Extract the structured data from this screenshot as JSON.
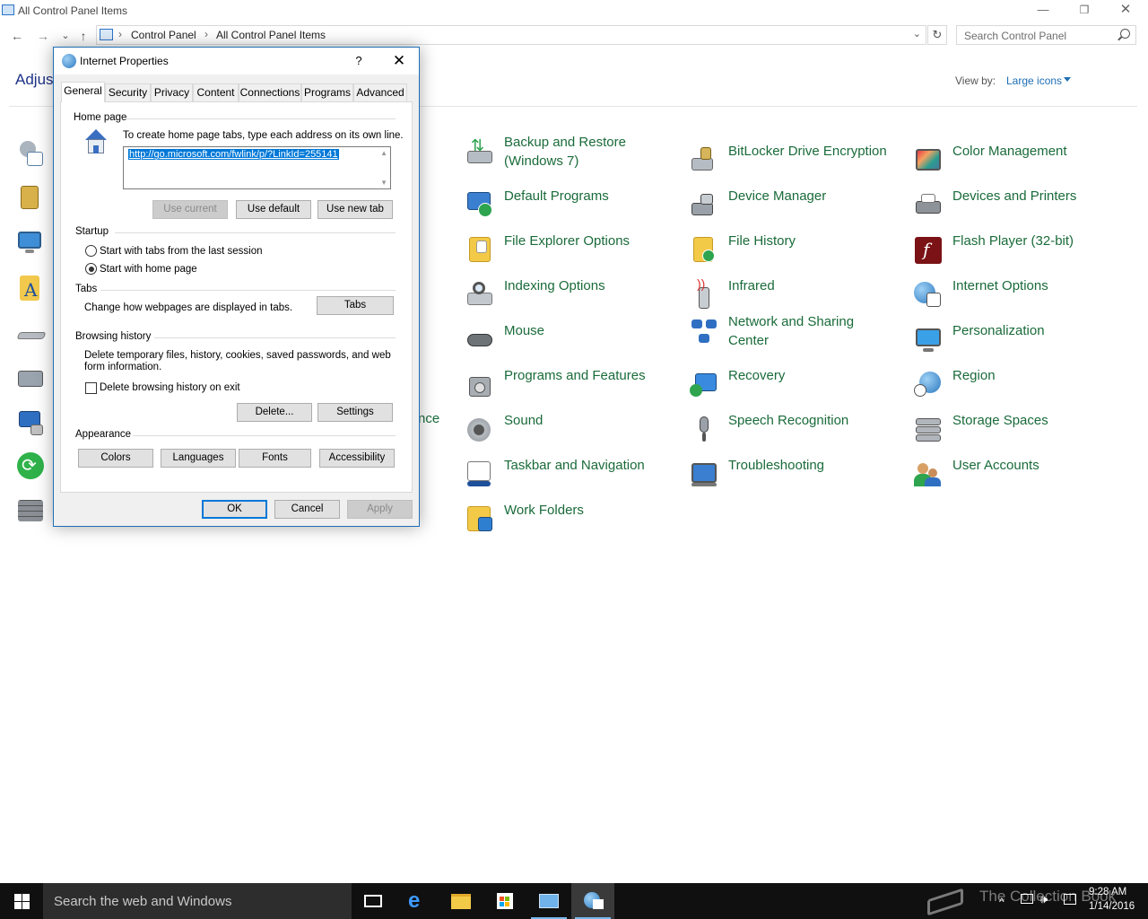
{
  "window": {
    "title": "All Control Panel Items",
    "minimize": "—",
    "restore": "❐",
    "close": "✕"
  },
  "address": {
    "crumbs": [
      "Control Panel",
      "All Control Panel Items"
    ],
    "separator": "›",
    "search_placeholder": "Search Control Panel",
    "refresh": "↻"
  },
  "nav": {
    "back": "←",
    "forward": "→",
    "recent": "⌄",
    "up": "↑"
  },
  "heading": "Adjust",
  "view_by": {
    "label": "View by:",
    "value": "Large icons"
  },
  "items": {
    "col1": [
      {
        "label": "Backup and Restore",
        "label2": "(Windows 7)",
        "icon": "backup-restore-icon"
      },
      {
        "label": "Default Programs",
        "icon": "default-programs-icon"
      },
      {
        "label": "File Explorer Options",
        "icon": "folder-options-icon"
      },
      {
        "label": "Indexing Options",
        "icon": "indexing-icon"
      },
      {
        "label": "Mouse",
        "icon": "mouse-icon"
      },
      {
        "label": "Programs and Features",
        "icon": "programs-features-icon"
      },
      {
        "label": "Sound",
        "icon": "sound-icon"
      },
      {
        "label": "Taskbar and Navigation",
        "icon": "taskbar-icon"
      },
      {
        "label": "Work Folders",
        "icon": "work-folders-icon"
      }
    ],
    "col2": [
      {
        "label": "BitLocker Drive Encryption",
        "icon": "bitlocker-icon"
      },
      {
        "label": "Device Manager",
        "icon": "device-manager-icon"
      },
      {
        "label": "File History",
        "icon": "file-history-icon"
      },
      {
        "label": "Infrared",
        "icon": "infrared-icon"
      },
      {
        "label": "Network and Sharing",
        "label2": "Center",
        "icon": "network-icon"
      },
      {
        "label": "Recovery",
        "icon": "recovery-icon"
      },
      {
        "label": "Speech Recognition",
        "icon": "microphone-icon"
      },
      {
        "label": "Troubleshooting",
        "icon": "troubleshooting-icon"
      }
    ],
    "col3": [
      {
        "label": "Color Management",
        "icon": "color-management-icon"
      },
      {
        "label": "Devices and Printers",
        "icon": "printer-icon"
      },
      {
        "label": "Flash Player (32-bit)",
        "icon": "flash-icon"
      },
      {
        "label": "Internet Options",
        "icon": "internet-options-icon"
      },
      {
        "label": "Personalization",
        "icon": "personalization-icon"
      },
      {
        "label": "Region",
        "icon": "region-icon"
      },
      {
        "label": "Storage Spaces",
        "icon": "storage-spaces-icon"
      },
      {
        "label": "User Accounts",
        "icon": "user-accounts-icon"
      }
    ],
    "partial_label": "nce"
  },
  "dialog": {
    "title": "Internet Properties",
    "help": "?",
    "close": "✕",
    "tabs": [
      "General",
      "Security",
      "Privacy",
      "Content",
      "Connections",
      "Programs",
      "Advanced"
    ],
    "home_page": {
      "group": "Home page",
      "instructions": "To create home page tabs, type each address on its own line.",
      "url": "http://go.microsoft.com/fwlink/p/?LinkId=255141",
      "use_current": "Use current",
      "use_default": "Use default",
      "use_new_tab": "Use new tab"
    },
    "startup": {
      "group": "Startup",
      "option1": "Start with tabs from the last session",
      "option2": "Start with home page"
    },
    "tabs_group": {
      "group": "Tabs",
      "description": "Change how webpages are displayed in tabs.",
      "button": "Tabs"
    },
    "browsing_history": {
      "group": "Browsing history",
      "description_line1": "Delete temporary files, history, cookies, saved passwords, and web",
      "description_line2": "form information.",
      "delete_on_exit": "Delete browsing history on exit",
      "delete": "Delete...",
      "settings": "Settings"
    },
    "appearance": {
      "group": "Appearance",
      "colors": "Colors",
      "languages": "Languages",
      "fonts": "Fonts",
      "accessibility": "Accessibility"
    },
    "ok": "OK",
    "cancel": "Cancel",
    "apply": "Apply"
  },
  "taskbar": {
    "search_placeholder": "Search the web and Windows",
    "time": "9:28 AM",
    "date": "1/14/2016",
    "watermark": "The Collection Book"
  },
  "colors": {
    "link_green": "#1a6b3a",
    "accent_blue": "#0078d7",
    "taskbar": "#101010"
  }
}
